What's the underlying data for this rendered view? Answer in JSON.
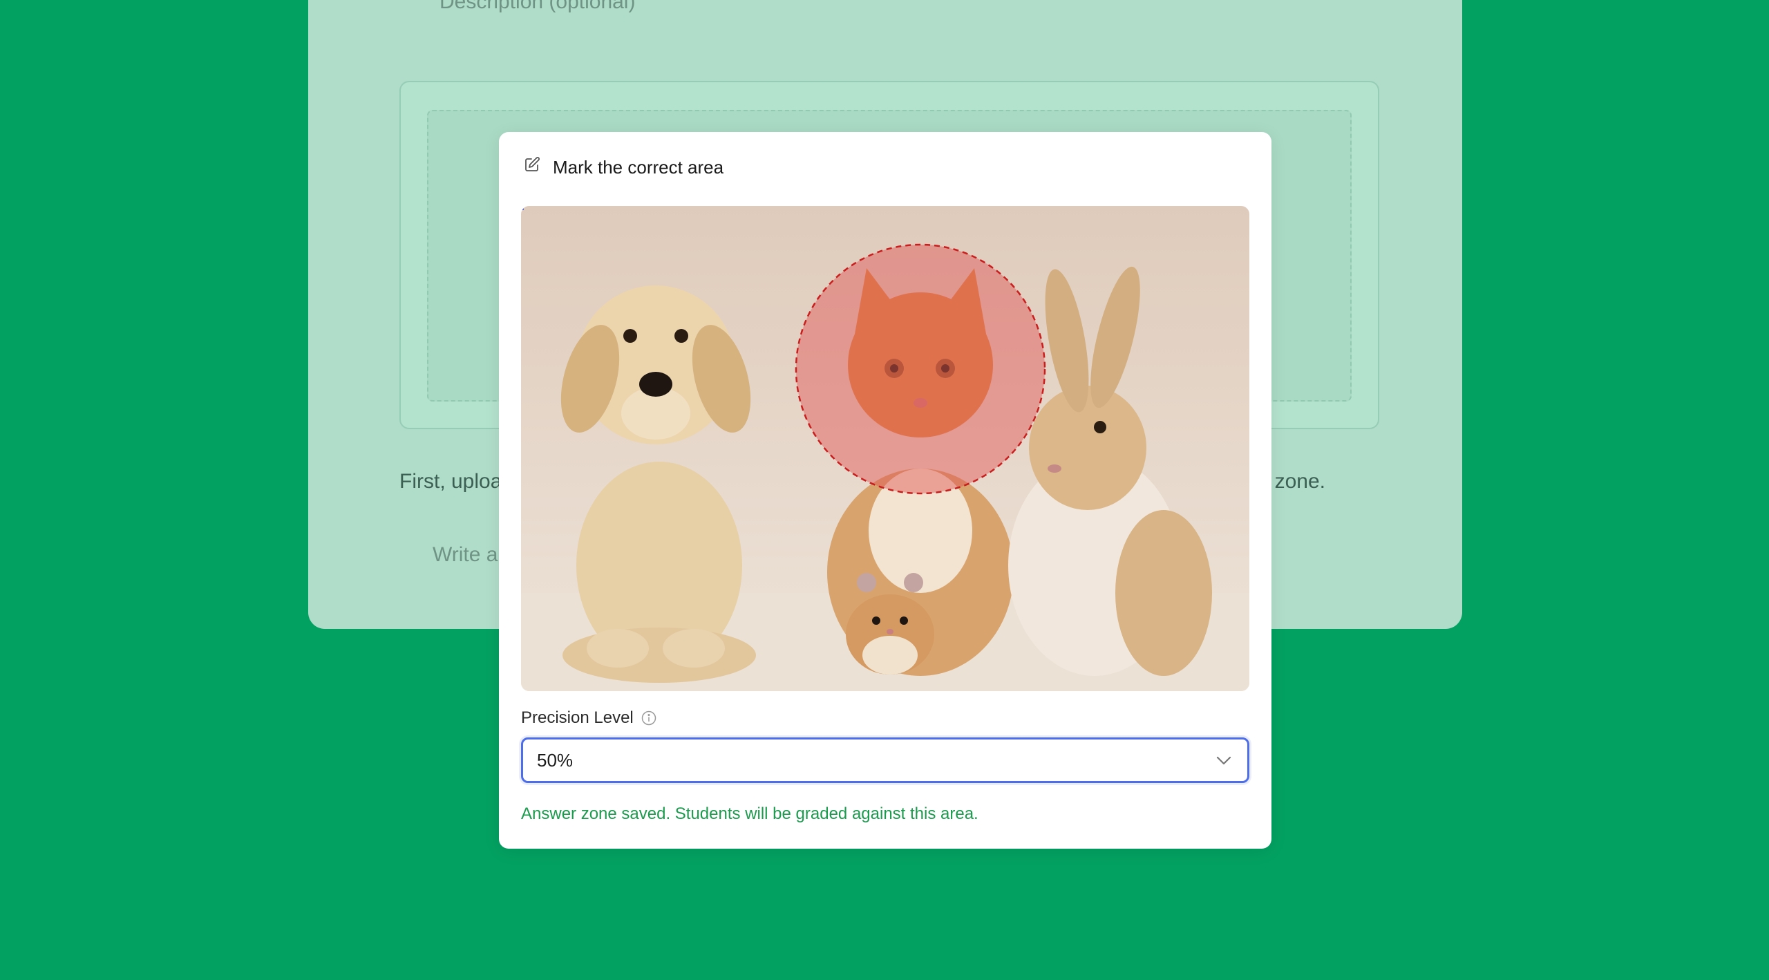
{
  "background": {
    "description_placeholder": "Description (optional)",
    "instructions_left": "First, uploa",
    "instructions_right": "zone.",
    "answer_placeholder": "Write a"
  },
  "modal": {
    "title": "Mark the correct area",
    "edit_icon": "edit-icon",
    "image_alt": "puppy, kitten, hamster and rabbit sitting together",
    "answer_zone_color": "#e05353",
    "precision": {
      "label": "Precision Level",
      "info_icon": "info-icon",
      "selected": "50%"
    },
    "status_message": "Answer zone saved. Students will be graded against this area."
  },
  "colors": {
    "page_background": "#03a161",
    "card_background": "#b0ddc9",
    "focus_border": "#4e6ee8",
    "success_text": "#1c9a4e"
  }
}
